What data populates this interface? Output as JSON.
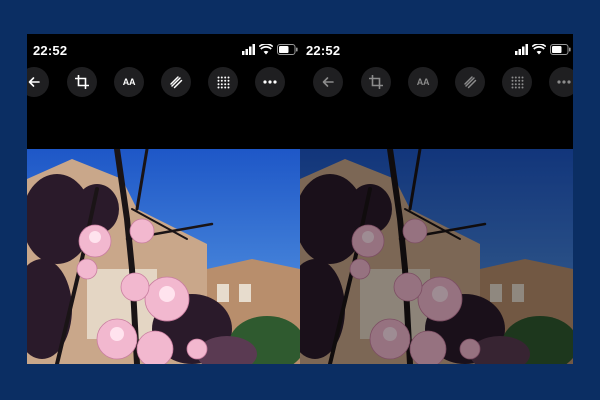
{
  "left_phone": {
    "status": {
      "time": "22:52"
    },
    "toolbar": {
      "back": "back-arrow-icon",
      "crop": "crop-icon",
      "text_label": "AA",
      "markup": "markup-pen-icon",
      "grid": "dot-grid-icon",
      "more": "more-icon"
    }
  },
  "right_phone": {
    "status": {
      "time": "22:52"
    },
    "toolbar": {
      "back": "back-arrow-icon",
      "crop": "crop-icon",
      "text_label": "AA",
      "markup": "markup-pen-icon",
      "grid": "dot-grid-icon",
      "more": "more-icon"
    },
    "state": "dimmed"
  },
  "colors": {
    "page_background": "#0b2e63",
    "phone_background": "#000000",
    "button_background": "#1f1f21",
    "sky_blue": "#2a6fd6",
    "blossom_pink": "#f2b8cf"
  }
}
